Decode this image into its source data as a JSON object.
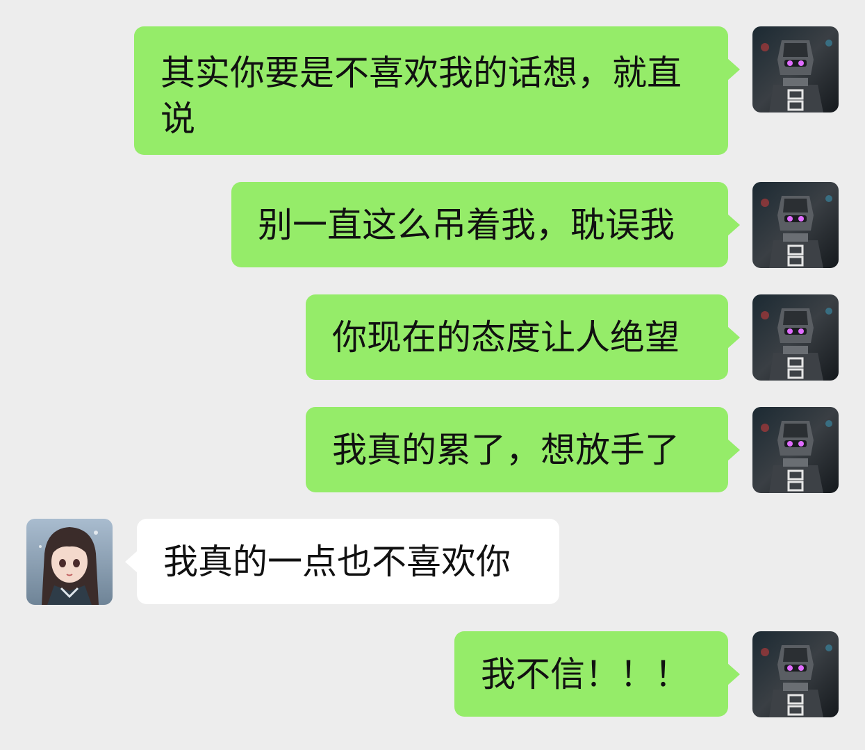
{
  "messages": [
    {
      "side": "sent",
      "text": "其实你要是不喜欢我的话想，就直说",
      "avatar": "robot-avatar"
    },
    {
      "side": "sent",
      "text": "别一直这么吊着我，耽误我",
      "avatar": "robot-avatar"
    },
    {
      "side": "sent",
      "text": "你现在的态度让人绝望",
      "avatar": "robot-avatar"
    },
    {
      "side": "sent",
      "text": "我真的累了，想放手了",
      "avatar": "robot-avatar"
    },
    {
      "side": "recv",
      "text": "我真的一点也不喜欢你",
      "avatar": "girl-avatar"
    },
    {
      "side": "sent",
      "text": "我不信！！！",
      "avatar": "robot-avatar"
    }
  ],
  "colors": {
    "sent_bubble": "#95ec69",
    "received_bubble": "#ffffff",
    "background": "#ededed"
  }
}
